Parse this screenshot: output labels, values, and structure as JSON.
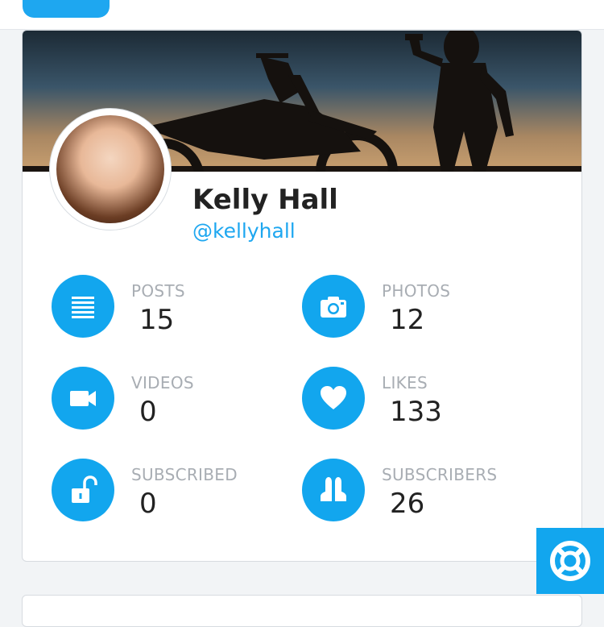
{
  "header": {
    "logo_icon": "app-logo"
  },
  "profile": {
    "name": "Kelly Hall",
    "handle": "@kellyhall"
  },
  "stats": [
    {
      "label": "POSTS",
      "value": "15",
      "icon": "list-icon"
    },
    {
      "label": "PHOTOS",
      "value": "12",
      "icon": "camera-icon"
    },
    {
      "label": "VIDEOS",
      "value": "0",
      "icon": "video-camera-icon"
    },
    {
      "label": "LIKES",
      "value": "133",
      "icon": "heart-icon"
    },
    {
      "label": "SUBSCRIBED",
      "value": "0",
      "icon": "unlock-icon"
    },
    {
      "label": "SUBSCRIBERS",
      "value": "26",
      "icon": "users-icon"
    }
  ],
  "help": {
    "icon": "life-ring-icon"
  },
  "colors": {
    "accent": "#12a6ee",
    "handle": "#1ea7f0",
    "label": "#a8adb3"
  }
}
